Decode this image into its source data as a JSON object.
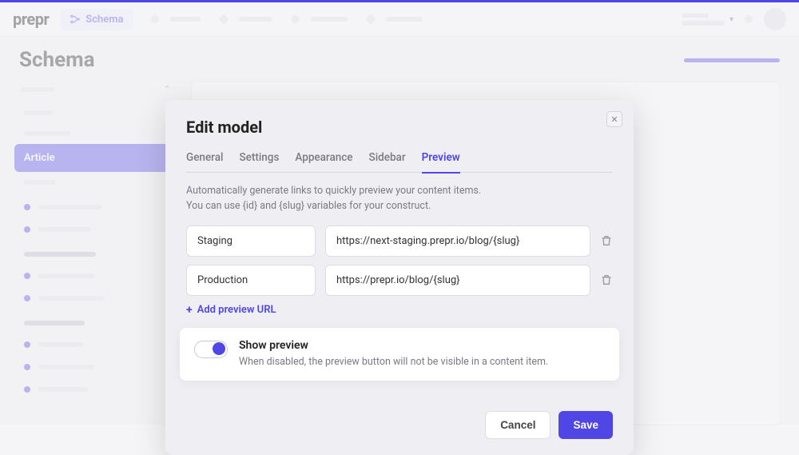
{
  "brand": "prepr",
  "topnav": {
    "schema": "Schema"
  },
  "page": {
    "title": "Schema"
  },
  "sidebar": {
    "active_item": "Article"
  },
  "modal": {
    "title": "Edit model",
    "tabs": {
      "general": "General",
      "settings": "Settings",
      "appearance": "Appearance",
      "sidebar": "Sidebar",
      "preview": "Preview"
    },
    "hint_line1": "Automatically generate links to quickly preview your content items.",
    "hint_line2": "You can use {id} and {slug} variables for your construct.",
    "rows": [
      {
        "name": "Staging",
        "url": "https://next-staging.prepr.io/blog/{slug}"
      },
      {
        "name": "Production",
        "url": "https://prepr.io/blog/{slug}"
      }
    ],
    "add_label": "Add preview URL",
    "toggle": {
      "label": "Show preview",
      "description": "When disabled, the preview button will not be visible in a content item."
    },
    "buttons": {
      "cancel": "Cancel",
      "save": "Save"
    }
  }
}
